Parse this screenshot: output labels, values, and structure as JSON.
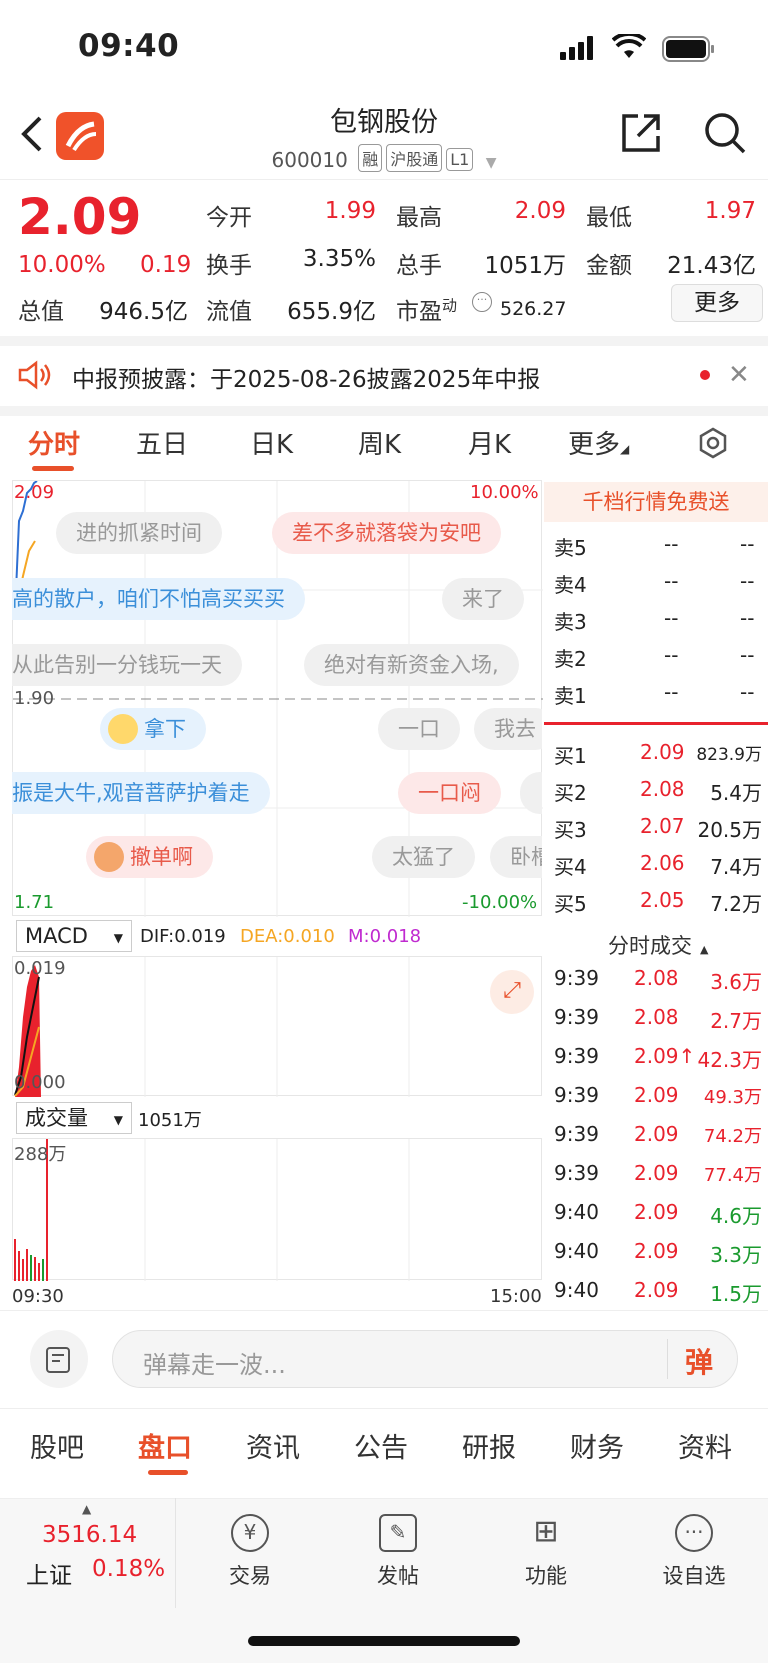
{
  "status_bar": {
    "time": "09:40"
  },
  "header": {
    "title": "包钢股份",
    "code": "600010",
    "tags": [
      "融",
      "沪股通",
      "L1"
    ]
  },
  "quote": {
    "price": "2.09",
    "change_pct": "10.00%",
    "change": "0.19",
    "rows": [
      [
        {
          "label": "今开",
          "value": "1.99",
          "color": "red"
        },
        {
          "label": "最高",
          "value": "2.09",
          "color": "red"
        },
        {
          "label": "最低",
          "value": "1.97",
          "color": "red"
        }
      ],
      [
        {
          "label": "换手",
          "value": "3.35%",
          "color": "black"
        },
        {
          "label": "总手",
          "value": "1051万",
          "color": "black"
        },
        {
          "label": "金额",
          "value": "21.43亿",
          "color": "black"
        }
      ]
    ],
    "total_value_label": "总值",
    "total_value": "946.5亿",
    "float_value_label": "流值",
    "float_value": "655.9亿",
    "pe_label": "市盈",
    "pe_sup": "动",
    "pe_value": "526.27",
    "more_label": "更多"
  },
  "notice": {
    "text": "中报预披露：于2025-08-26披露2025年中报"
  },
  "chart_tabs": [
    "分时",
    "五日",
    "日K",
    "周K",
    "月K",
    "更多"
  ],
  "chart": {
    "price_top": "2.09",
    "pct_top": "10.00%",
    "price_mid": "1.90",
    "price_bottom": "1.71",
    "pct_bottom": "-10.00%",
    "time_start": "09:30",
    "time_end": "15:00",
    "macd_selector": "MACD",
    "dif": "DIF:0.019",
    "dea": "DEA:0.010",
    "m": "M:0.018",
    "macd_top": "0.019",
    "macd_bottom": "0.000",
    "volume_selector": "成交量",
    "volume_total": "1051万",
    "volume_top": "288万"
  },
  "danmu": [
    {
      "text": "进的抓紧时间",
      "style": "g"
    },
    {
      "text": "差不多就落袋为安吧",
      "style": "r"
    },
    {
      "text": "高的散户，咱们不怕高买买买",
      "style": "b"
    },
    {
      "text": "来了",
      "style": "g"
    },
    {
      "text": "从此告别一分钱玩一天",
      "style": "g"
    },
    {
      "text": "绝对有新资金入场,",
      "style": "g"
    },
    {
      "text": "拿下",
      "style": "b"
    },
    {
      "text": "一口",
      "style": "g"
    },
    {
      "text": "我去",
      "style": "g"
    },
    {
      "text": "振是大牛,观音菩萨护着走",
      "style": "b"
    },
    {
      "text": "一口闷",
      "style": "r"
    },
    {
      "text": "撤单啊",
      "style": "r"
    },
    {
      "text": "太猛了",
      "style": "g"
    },
    {
      "text": "卧槽",
      "style": "g"
    }
  ],
  "orderbook": {
    "banner": "千档行情免费送",
    "asks": [
      {
        "label": "卖5",
        "price": "--",
        "vol": "--"
      },
      {
        "label": "卖4",
        "price": "--",
        "vol": "--"
      },
      {
        "label": "卖3",
        "price": "--",
        "vol": "--"
      },
      {
        "label": "卖2",
        "price": "--",
        "vol": "--"
      },
      {
        "label": "卖1",
        "price": "--",
        "vol": "--"
      }
    ],
    "bids": [
      {
        "label": "买1",
        "price": "2.09",
        "vol": "823.9万"
      },
      {
        "label": "买2",
        "price": "2.08",
        "vol": "5.4万"
      },
      {
        "label": "买3",
        "price": "2.07",
        "vol": "20.5万"
      },
      {
        "label": "买4",
        "price": "2.06",
        "vol": "7.4万"
      },
      {
        "label": "买5",
        "price": "2.05",
        "vol": "7.2万"
      }
    ],
    "trades_title": "分时成交",
    "trades": [
      {
        "time": "9:39",
        "price": "2.08",
        "vol": "3.6万",
        "color": "red"
      },
      {
        "time": "9:39",
        "price": "2.08",
        "vol": "2.7万",
        "color": "red"
      },
      {
        "time": "9:39",
        "price": "2.09↑",
        "vol": "42.3万",
        "color": "red"
      },
      {
        "time": "9:39",
        "price": "2.09",
        "vol": "49.3万",
        "color": "red"
      },
      {
        "time": "9:39",
        "price": "2.09",
        "vol": "74.2万",
        "color": "red"
      },
      {
        "time": "9:39",
        "price": "2.09",
        "vol": "77.4万",
        "color": "red"
      },
      {
        "time": "9:40",
        "price": "2.09",
        "vol": "4.6万",
        "color": "green"
      },
      {
        "time": "9:40",
        "price": "2.09",
        "vol": "3.3万",
        "color": "green"
      },
      {
        "time": "9:40",
        "price": "2.09",
        "vol": "1.5万",
        "color": "green"
      }
    ]
  },
  "comment": {
    "placeholder": "弹幕走一波...",
    "danmu_btn": "弹"
  },
  "bottom_tabs": [
    "股吧",
    "盘口",
    "资讯",
    "公告",
    "研报",
    "财务",
    "资料"
  ],
  "index": {
    "value": "3516.14",
    "name": "上证",
    "pct": "0.18%"
  },
  "nav": [
    {
      "label": "交易",
      "icon": "yen-icon"
    },
    {
      "label": "发帖",
      "icon": "edit-icon"
    },
    {
      "label": "功能",
      "icon": "grid-icon"
    },
    {
      "label": "设自选",
      "icon": "more-icon"
    }
  ]
}
